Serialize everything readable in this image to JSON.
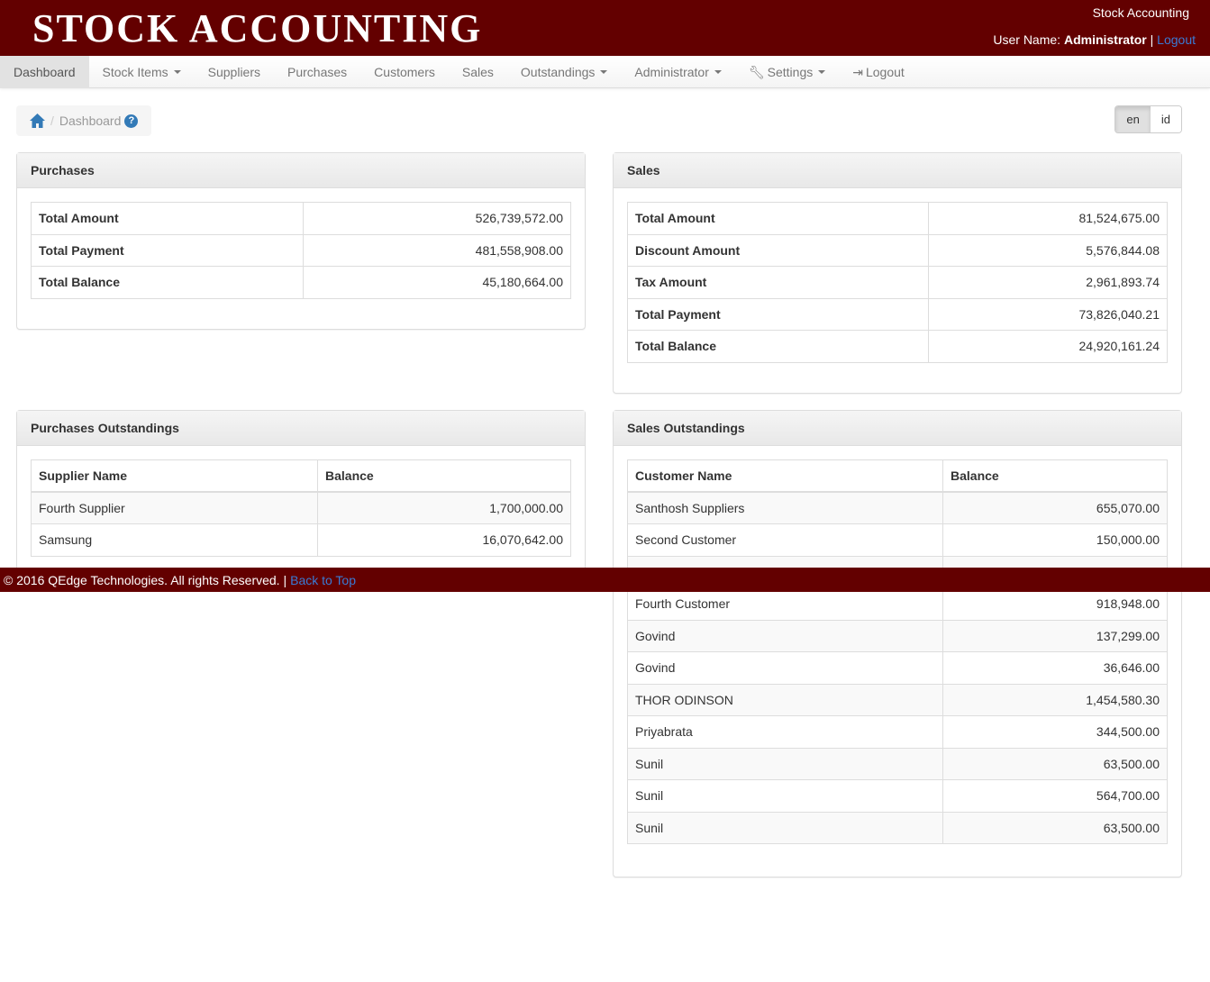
{
  "header": {
    "logo": "STOCK ACCOUNTING",
    "app_name": "Stock Accounting",
    "user_label": "User Name:",
    "user": "Administrator",
    "sep": "|",
    "logout": "Logout"
  },
  "nav": [
    {
      "label": "Dashboard"
    },
    {
      "label": "Stock Items"
    },
    {
      "label": "Suppliers"
    },
    {
      "label": "Purchases"
    },
    {
      "label": "Customers"
    },
    {
      "label": "Sales"
    },
    {
      "label": "Outstandings"
    },
    {
      "label": "Administrator"
    },
    {
      "label": "Settings"
    },
    {
      "label": "Logout"
    }
  ],
  "breadcrumb": {
    "current": "Dashboard",
    "sep": "/"
  },
  "lang": {
    "en": "en",
    "id": "id"
  },
  "purchases": {
    "title": "Purchases",
    "rows": [
      {
        "label": "Total Amount",
        "value": "526,739,572.00"
      },
      {
        "label": "Total Payment",
        "value": "481,558,908.00"
      },
      {
        "label": "Total Balance",
        "value": "45,180,664.00"
      }
    ]
  },
  "sales": {
    "title": "Sales",
    "rows": [
      {
        "label": "Total Amount",
        "value": "81,524,675.00"
      },
      {
        "label": "Discount Amount",
        "value": "5,576,844.08"
      },
      {
        "label": "Tax Amount",
        "value": "2,961,893.74"
      },
      {
        "label": "Total Payment",
        "value": "73,826,040.21"
      },
      {
        "label": "Total Balance",
        "value": "24,920,161.24"
      }
    ]
  },
  "purchases_outstandings": {
    "title": "Purchases Outstandings",
    "col1": "Supplier Name",
    "col2": "Balance",
    "rows": [
      {
        "name": "Fourth Supplier",
        "balance": "1,700,000.00"
      },
      {
        "name": "Samsung",
        "balance": "16,070,642.00"
      }
    ]
  },
  "sales_outstandings": {
    "title": "Sales Outstandings",
    "col1": "Customer Name",
    "col2": "Balance",
    "rows": [
      {
        "name": "Santhosh Suppliers",
        "balance": "655,070.00"
      },
      {
        "name": "Second Customer",
        "balance": "150,000.00"
      },
      {
        "name": "",
        "balance": ""
      },
      {
        "name": "Fourth Customer",
        "balance": "918,948.00"
      },
      {
        "name": "Govind",
        "balance": "137,299.00"
      },
      {
        "name": "Govind",
        "balance": "36,646.00"
      },
      {
        "name": "THOR ODINSON",
        "balance": "1,454,580.30"
      },
      {
        "name": "Priyabrata",
        "balance": "344,500.00"
      },
      {
        "name": "Sunil",
        "balance": "63,500.00"
      },
      {
        "name": "Sunil",
        "balance": "564,700.00"
      },
      {
        "name": "Sunil",
        "balance": "63,500.00"
      }
    ]
  },
  "footer": {
    "text": "© 2016 QEdge Technologies. All rights Reserved. |",
    "link": "Back to Top"
  }
}
